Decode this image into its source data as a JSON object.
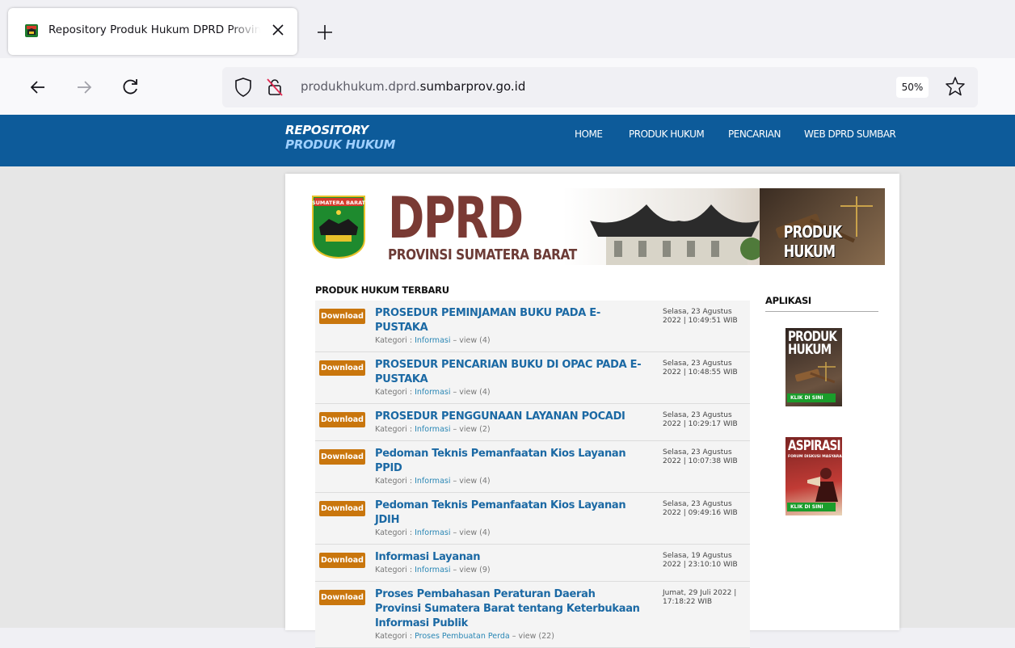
{
  "browser": {
    "tab_title": "Repository Produk Hukum DPRD Provinsi Sumatera Barat",
    "url_prefix": "produkhukum.dprd.",
    "url_domain": "sumbarprov.go.id",
    "zoom": "50%"
  },
  "site": {
    "brand_line1": "REPOSITORY",
    "brand_line2": "PRODUK HUKUM",
    "nav": [
      "HOME",
      "PRODUK HUKUM",
      "PENCARIAN",
      "WEB DPRD SUMBAR"
    ]
  },
  "banner": {
    "logo_text_top": "SUMATERA BARAT",
    "title": "DPRD",
    "subtitle": "PROVINSI SUMATERA BARAT",
    "right_label": "PRODUK HUKUM"
  },
  "latest": {
    "heading": "PRODUK HUKUM TERBARU",
    "download_label": "Download",
    "items": [
      {
        "title": "PROSEDUR PEMINJAMAN BUKU PADA E-PUSTAKA",
        "category": "Informasi",
        "views": "view (4)",
        "date": "Selasa, 23 Agustus 2022 | 10:49:51 WIB"
      },
      {
        "title": "PROSEDUR PENCARIAN BUKU DI OPAC PADA E-PUSTAKA",
        "category": "Informasi",
        "views": "view (4)",
        "date": "Selasa, 23 Agustus 2022 | 10:48:55 WIB"
      },
      {
        "title": "PROSEDUR PENGGUNAAN LAYANAN POCADI",
        "category": "Informasi",
        "views": "view (2)",
        "date": "Selasa, 23 Agustus 2022 | 10:29:17 WIB"
      },
      {
        "title": "Pedoman Teknis Pemanfaatan Kios Layanan PPID",
        "category": "Informasi",
        "views": "view (4)",
        "date": "Selasa, 23 Agustus 2022 | 10:07:38 WIB"
      },
      {
        "title": "Pedoman Teknis Pemanfaatan Kios Layanan JDIH",
        "category": "Informasi",
        "views": "view (4)",
        "date": "Selasa, 23 Agustus 2022 | 09:49:16 WIB"
      },
      {
        "title": "Informasi Layanan",
        "category": "Informasi",
        "views": "view (9)",
        "date": "Selasa, 19 Agustus 2022 | 23:10:10 WIB"
      },
      {
        "title": "Proses Pembahasan Peraturan Daerah Provinsi Sumatera Barat tentang Keterbukaan Informasi Publik",
        "category": "Proses Pembuatan Perda",
        "views": "view (22)",
        "date": "Jumat, 29 Juli 2022 | 17:18:22 WIB"
      }
    ],
    "category_prefix": "Kategori : ",
    "sep": " – "
  },
  "aplikasi": {
    "heading": "APLIKASI",
    "app1_title": "PRODUK HUKUM",
    "app2_title": "ASPIRASI",
    "app2_sub": "FORUM DISKUSI MASYARAKAT",
    "klik": "KLIK DI SINI"
  },
  "colors": {
    "header": "#0d5b9a",
    "download": "#c9760d",
    "link": "#1b69a4"
  }
}
